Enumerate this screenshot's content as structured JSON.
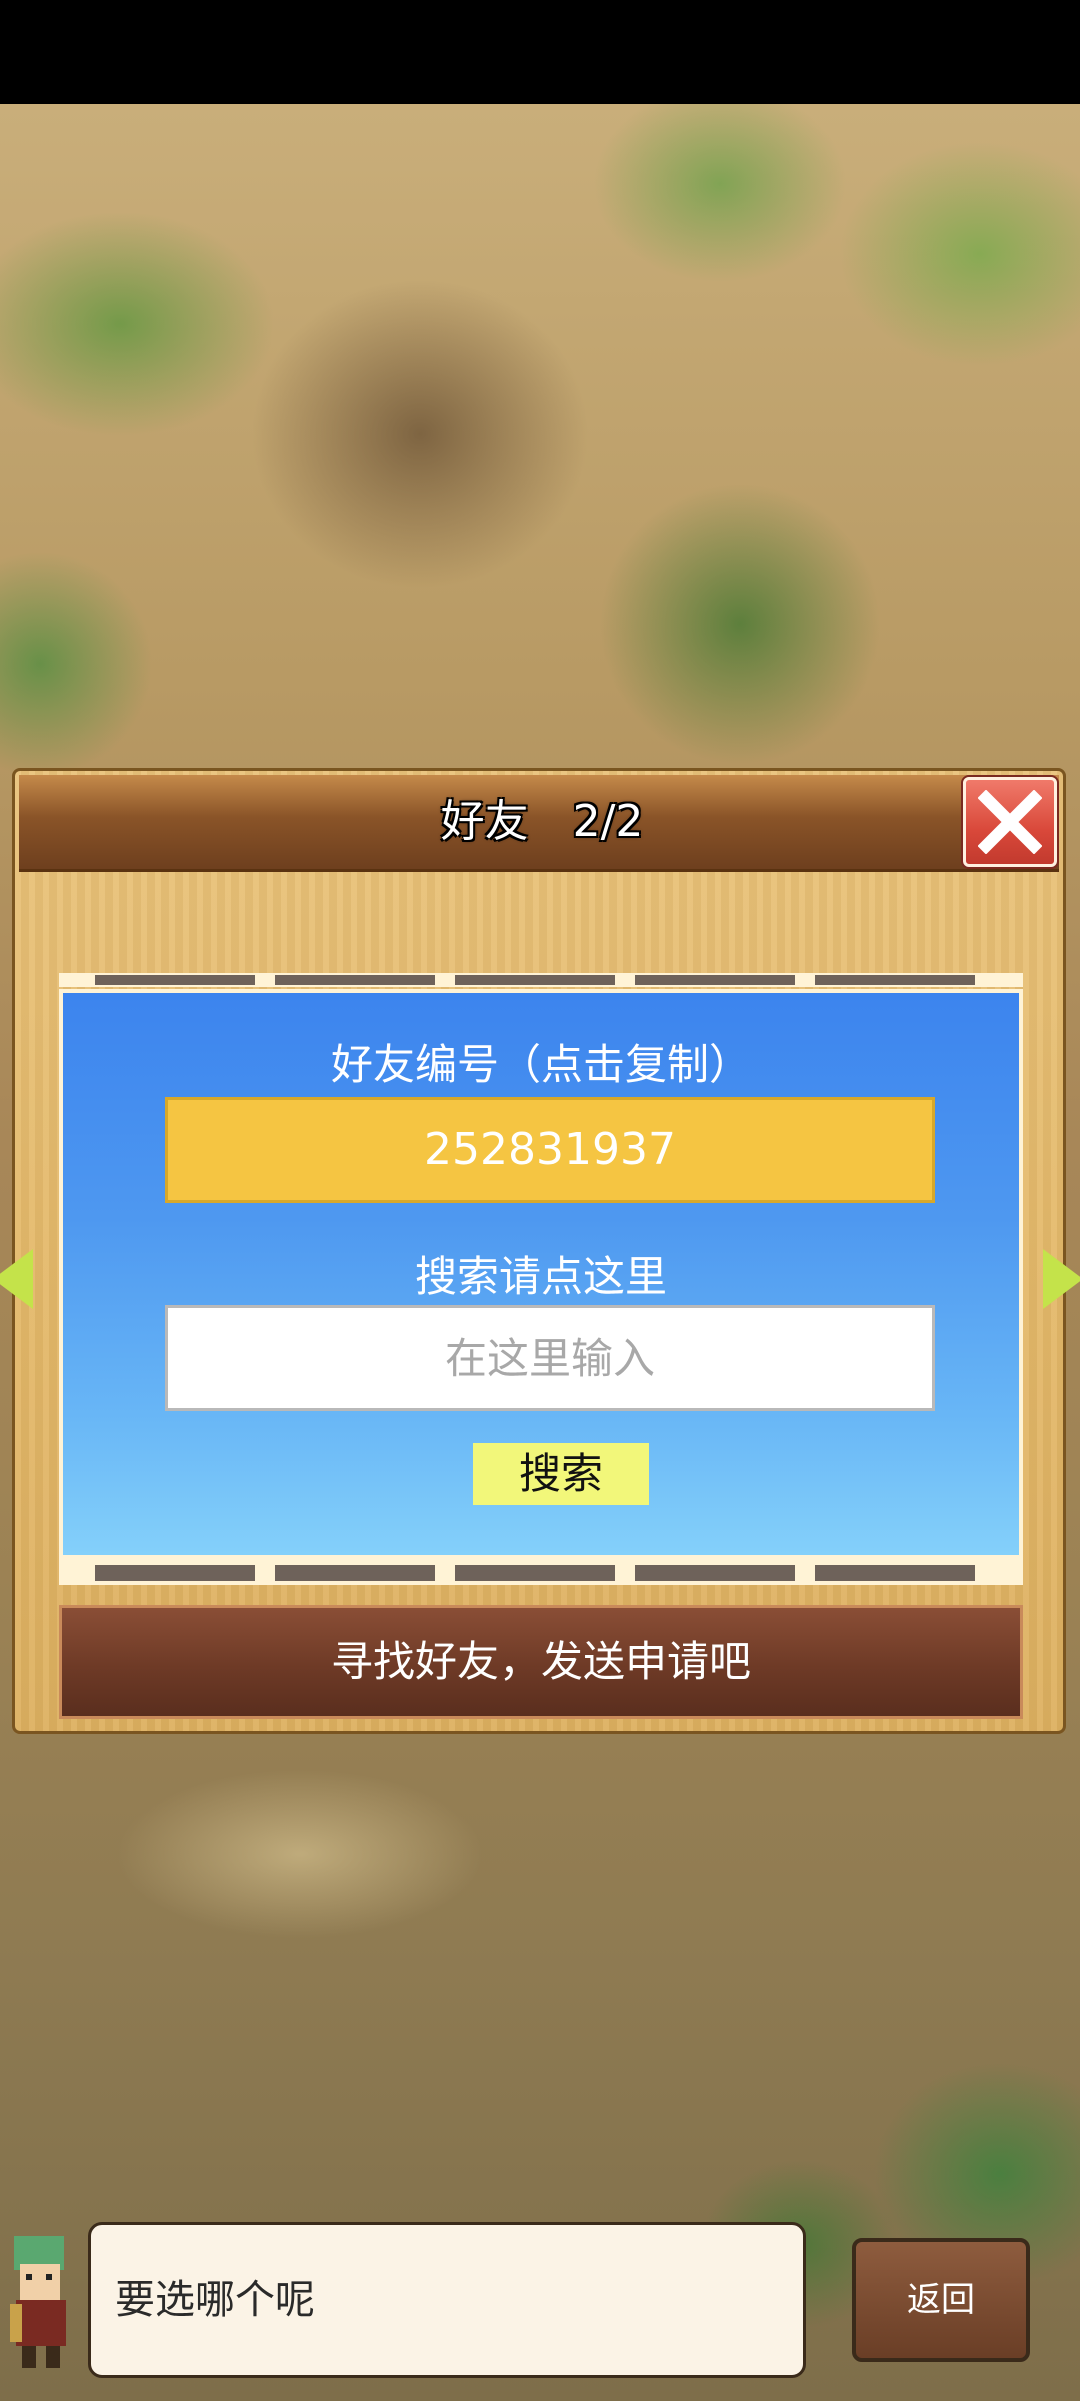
{
  "dialog": {
    "title_label": "好友",
    "title_count": "2/2"
  },
  "friend_code": {
    "label": "好友编号（点击复制）",
    "value": "252831937"
  },
  "search": {
    "hint": "搜索请点这里",
    "placeholder": "在这里输入",
    "button_label": "搜索"
  },
  "banner": {
    "find_friends_label": "寻找好友，发送申请吧"
  },
  "bottom": {
    "prompt": "要选哪个呢",
    "back_label": "返回"
  },
  "colors": {
    "close_button": "#d9483a",
    "friend_code_bg": "#f5c542",
    "search_button_bg": "#f2f77a",
    "banner_bg": "#6e3a26",
    "arrow": "#c4e34a"
  },
  "icons": {
    "close": "close-icon",
    "left_arrow": "left-arrow-icon",
    "right_arrow": "right-arrow-icon"
  }
}
